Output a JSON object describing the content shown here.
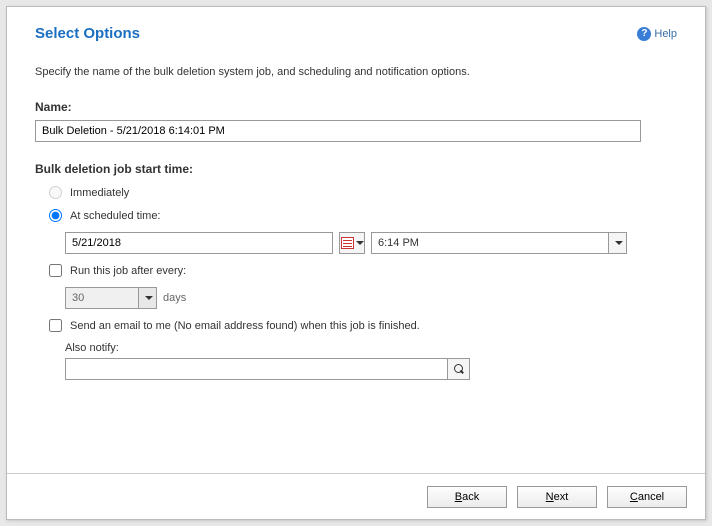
{
  "header": {
    "title": "Select Options",
    "help_label": "Help"
  },
  "instruction": "Specify the name of the bulk deletion system job, and scheduling and notification options.",
  "name": {
    "label": "Name:",
    "value": "Bulk Deletion - 5/21/2018 6:14:01 PM"
  },
  "start_time": {
    "label": "Bulk deletion job start time:",
    "immediately_label": "Immediately",
    "scheduled_label": "At scheduled time:",
    "date_value": "5/21/2018",
    "time_value": "6:14 PM"
  },
  "repeat": {
    "label": "Run this job after every:",
    "value": "30",
    "unit": "days"
  },
  "notify": {
    "label": "Send an email to me (No email address found) when this job is finished.",
    "also_label": "Also notify:",
    "value": ""
  },
  "footer": {
    "back": {
      "u": "B",
      "rest": "ack"
    },
    "next": {
      "u": "N",
      "rest": "ext"
    },
    "cancel": {
      "u": "C",
      "rest": "ancel"
    }
  }
}
